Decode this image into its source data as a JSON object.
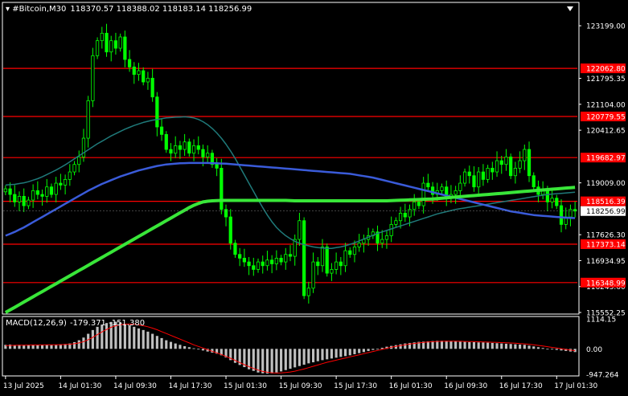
{
  "header": {
    "symbol": "#Bitcoin,M30",
    "ohlc": "118370.57 118388.02 118183.14 118256.99"
  },
  "macd_header": {
    "label": "MACD(12,26,9)",
    "values": "-179.371 -151.380"
  },
  "colors": {
    "background": "#000000",
    "candle": "#00ff00",
    "ma_fast": "#1f7a7a",
    "ma_mid": "#3a5bd9",
    "ma_slow": "#39e639",
    "level_line": "#ff0000",
    "price_tag": "#ff0000",
    "current_price_tag": "#ffffff",
    "macd_hist": "#c0c0c0",
    "macd_signal": "#ff0000",
    "axis_text": "#ffffff",
    "frame": "#ffffff"
  },
  "chart_data": {
    "type": "candlestick",
    "timeframe": "M30",
    "ylim": [
      115552.25,
      123500
    ],
    "y_ticks": [
      "123199.00",
      "121795.35",
      "121104.00",
      "120412.65",
      "119009.00",
      "117626.30",
      "116934.95",
      "116243.60",
      "115552.25"
    ],
    "level_lines": [
      {
        "price": 122062.8,
        "label": "122062.80"
      },
      {
        "price": 120779.55,
        "label": "120779.55"
      },
      {
        "price": 119682.97,
        "label": "119682.97"
      },
      {
        "price": 118516.39,
        "label": "118516.39"
      },
      {
        "price": 117373.14,
        "label": "117373.14"
      },
      {
        "price": 116348.99,
        "label": "116348.99"
      }
    ],
    "current_price": {
      "price": 118256.99,
      "label": "118256.99"
    },
    "x_ticks": [
      {
        "index": 0,
        "label": "13 Jul 2025"
      },
      {
        "index": 12,
        "label": "14 Jul 01:30"
      },
      {
        "index": 24,
        "label": "14 Jul 09:30"
      },
      {
        "index": 36,
        "label": "14 Jul 17:30"
      },
      {
        "index": 48,
        "label": "15 Jul 01:30"
      },
      {
        "index": 60,
        "label": "15 Jul 09:30"
      },
      {
        "index": 72,
        "label": "15 Jul 17:30"
      },
      {
        "index": 84,
        "label": "16 Jul 01:30"
      },
      {
        "index": 96,
        "label": "16 Jul 09:30"
      },
      {
        "index": 108,
        "label": "16 Jul 17:30"
      },
      {
        "index": 120,
        "label": "17 Jul 01:30"
      }
    ],
    "close": [
      118850,
      118700,
      118500,
      118650,
      118400,
      118550,
      118800,
      118700,
      118650,
      118900,
      118700,
      119000,
      118950,
      119100,
      119300,
      119500,
      119700,
      120200,
      121200,
      122400,
      122800,
      123000,
      122500,
      122800,
      122600,
      122900,
      122300,
      122100,
      121900,
      122000,
      121700,
      121800,
      121300,
      120500,
      120300,
      119900,
      119800,
      120000,
      119900,
      120100,
      119800,
      120000,
      119900,
      119700,
      119800,
      119500,
      119400,
      118300,
      118100,
      117400,
      117100,
      117000,
      116900,
      116800,
      116700,
      116900,
      116800,
      116950,
      116850,
      117000,
      116900,
      117100,
      117050,
      117500,
      118000,
      116000,
      116200,
      116900,
      116800,
      117300,
      116600,
      116700,
      116900,
      116800,
      117200,
      117100,
      117300,
      117400,
      117500,
      117600,
      117700,
      117400,
      117500,
      117600,
      117900,
      118000,
      118200,
      118100,
      118300,
      118500,
      118400,
      119000,
      118900,
      118700,
      118800,
      118900,
      118600,
      118700,
      118800,
      119000,
      119300,
      119200,
      118900,
      119300,
      119100,
      119400,
      119300,
      119600,
      119500,
      119700,
      119200,
      119400,
      119600,
      119900,
      119200,
      118900,
      118700,
      118800,
      118500,
      118600,
      118400,
      117900,
      118100,
      118300,
      118256.99
    ],
    "ma_fast": [
      118950,
      118960,
      118970,
      118990,
      119010,
      119040,
      119080,
      119120,
      119170,
      119230,
      119290,
      119350,
      119420,
      119490,
      119570,
      119650,
      119730,
      119810,
      119890,
      119970,
      120050,
      120120,
      120190,
      120260,
      120320,
      120380,
      120440,
      120490,
      120540,
      120580,
      120620,
      120650,
      120680,
      120700,
      120720,
      120740,
      120750,
      120760,
      120765,
      120770,
      120760,
      120740,
      120700,
      120640,
      120560,
      120460,
      120340,
      120200,
      120040,
      119860,
      119660,
      119440,
      119220,
      119000,
      118780,
      118560,
      118350,
      118150,
      117970,
      117820,
      117700,
      117600,
      117520,
      117450,
      117400,
      117360,
      117330,
      117300,
      117280,
      117270,
      117260,
      117260,
      117280,
      117300,
      117330,
      117370,
      117410,
      117460,
      117510,
      117560,
      117610,
      117660,
      117700,
      117740,
      117780,
      117820,
      117860,
      117900,
      117940,
      117980,
      118020,
      118060,
      118100,
      118140,
      118180,
      118210,
      118240,
      118270,
      118300,
      118320,
      118340,
      118360,
      118380,
      118400,
      118420,
      118440,
      118460,
      118480,
      118500,
      118520,
      118540,
      118560,
      118580,
      118600,
      118620,
      118640,
      118660,
      118680,
      118700,
      118710,
      118720,
      118730,
      118740,
      118750,
      118760
    ],
    "ma_mid": [
      117600,
      117650,
      117700,
      117760,
      117820,
      117890,
      117960,
      118030,
      118100,
      118170,
      118240,
      118310,
      118380,
      118450,
      118520,
      118590,
      118660,
      118730,
      118800,
      118860,
      118920,
      118980,
      119030,
      119080,
      119130,
      119180,
      119220,
      119260,
      119300,
      119340,
      119370,
      119400,
      119430,
      119460,
      119480,
      119500,
      119510,
      119520,
      119530,
      119535,
      119540,
      119540,
      119540,
      119540,
      119540,
      119535,
      119530,
      119525,
      119520,
      119510,
      119500,
      119490,
      119480,
      119470,
      119460,
      119450,
      119440,
      119430,
      119420,
      119410,
      119400,
      119390,
      119380,
      119370,
      119360,
      119350,
      119340,
      119330,
      119320,
      119310,
      119300,
      119290,
      119280,
      119270,
      119260,
      119250,
      119230,
      119210,
      119190,
      119170,
      119150,
      119120,
      119090,
      119060,
      119030,
      119000,
      118970,
      118940,
      118910,
      118880,
      118850,
      118820,
      118790,
      118760,
      118730,
      118700,
      118670,
      118640,
      118610,
      118580,
      118550,
      118520,
      118490,
      118460,
      118430,
      118400,
      118370,
      118340,
      118310,
      118280,
      118250,
      118230,
      118210,
      118190,
      118170,
      118150,
      118140,
      118130,
      118120,
      118110,
      118100,
      118090,
      118080,
      118075,
      118070
    ],
    "ma_slow": [
      115552,
      115620,
      115690,
      115760,
      115830,
      115900,
      115970,
      116040,
      116110,
      116180,
      116250,
      116320,
      116390,
      116460,
      116530,
      116600,
      116670,
      116740,
      116810,
      116880,
      116950,
      117020,
      117090,
      117160,
      117230,
      117300,
      117370,
      117440,
      117510,
      117580,
      117650,
      117720,
      117790,
      117860,
      117930,
      118000,
      118070,
      118140,
      118210,
      118280,
      118350,
      118410,
      118460,
      118500,
      118520,
      118530,
      118535,
      118540,
      118540,
      118540,
      118540,
      118540,
      118540,
      118540,
      118540,
      118540,
      118540,
      118540,
      118540,
      118540,
      118540,
      118540,
      118535,
      118530,
      118530,
      118530,
      118530,
      118530,
      118530,
      118530,
      118530,
      118530,
      118530,
      118530,
      118530,
      118530,
      118530,
      118530,
      118530,
      118530,
      118530,
      118530,
      118530,
      118530,
      118535,
      118540,
      118545,
      118550,
      118555,
      118560,
      118565,
      118570,
      118575,
      118580,
      118590,
      118600,
      118610,
      118620,
      118630,
      118640,
      118650,
      118660,
      118670,
      118680,
      118690,
      118700,
      118710,
      118720,
      118730,
      118740,
      118750,
      118760,
      118770,
      118780,
      118790,
      118800,
      118810,
      118820,
      118830,
      118840,
      118850,
      118860,
      118870,
      118880,
      118890
    ],
    "macd": {
      "ylim": [
        -947.264,
        1114.15
      ],
      "y_ticks": [
        "1114.15",
        "0.00",
        "-947.264"
      ],
      "hist": [
        150,
        160,
        140,
        150,
        130,
        150,
        160,
        150,
        140,
        150,
        140,
        160,
        170,
        180,
        200,
        250,
        320,
        420,
        560,
        700,
        820,
        900,
        960,
        1000,
        1010,
        980,
        930,
        880,
        820,
        760,
        700,
        640,
        560,
        480,
        400,
        320,
        260,
        200,
        150,
        100,
        60,
        20,
        -20,
        -60,
        -100,
        -140,
        -180,
        -240,
        -320,
        -420,
        -520,
        -600,
        -680,
        -760,
        -820,
        -880,
        -910,
        -920,
        -910,
        -880,
        -840,
        -790,
        -740,
        -690,
        -640,
        -590,
        -540,
        -500,
        -460,
        -420,
        -390,
        -360,
        -330,
        -300,
        -270,
        -240,
        -200,
        -160,
        -120,
        -80,
        -40,
        0,
        40,
        80,
        110,
        140,
        170,
        200,
        220,
        240,
        260,
        270,
        280,
        290,
        300,
        300,
        300,
        290,
        280,
        270,
        260,
        250,
        250,
        240,
        240,
        230,
        220,
        210,
        200,
        190,
        180,
        170,
        160,
        150,
        120,
        90,
        60,
        30,
        0,
        -20,
        -40,
        -60,
        -80,
        -100,
        -120
      ],
      "signal": [
        120,
        125,
        130,
        135,
        138,
        140,
        142,
        144,
        146,
        148,
        150,
        152,
        155,
        160,
        170,
        190,
        220,
        270,
        340,
        430,
        530,
        630,
        720,
        800,
        860,
        900,
        920,
        920,
        910,
        890,
        860,
        820,
        770,
        710,
        640,
        570,
        500,
        430,
        360,
        290,
        220,
        150,
        90,
        30,
        -30,
        -90,
        -150,
        -210,
        -280,
        -350,
        -430,
        -510,
        -590,
        -660,
        -730,
        -790,
        -840,
        -870,
        -890,
        -900,
        -895,
        -880,
        -860,
        -830,
        -790,
        -750,
        -700,
        -650,
        -600,
        -550,
        -500,
        -460,
        -420,
        -380,
        -340,
        -300,
        -260,
        -220,
        -180,
        -140,
        -100,
        -60,
        -20,
        20,
        60,
        90,
        120,
        150,
        180,
        200,
        220,
        240,
        255,
        265,
        275,
        280,
        285,
        285,
        283,
        280,
        276,
        272,
        268,
        263,
        258,
        252,
        246,
        240,
        234,
        226,
        218,
        208,
        198,
        186,
        170,
        150,
        128,
        105,
        80,
        55,
        30,
        5,
        -20,
        -45,
        -70
      ]
    }
  }
}
